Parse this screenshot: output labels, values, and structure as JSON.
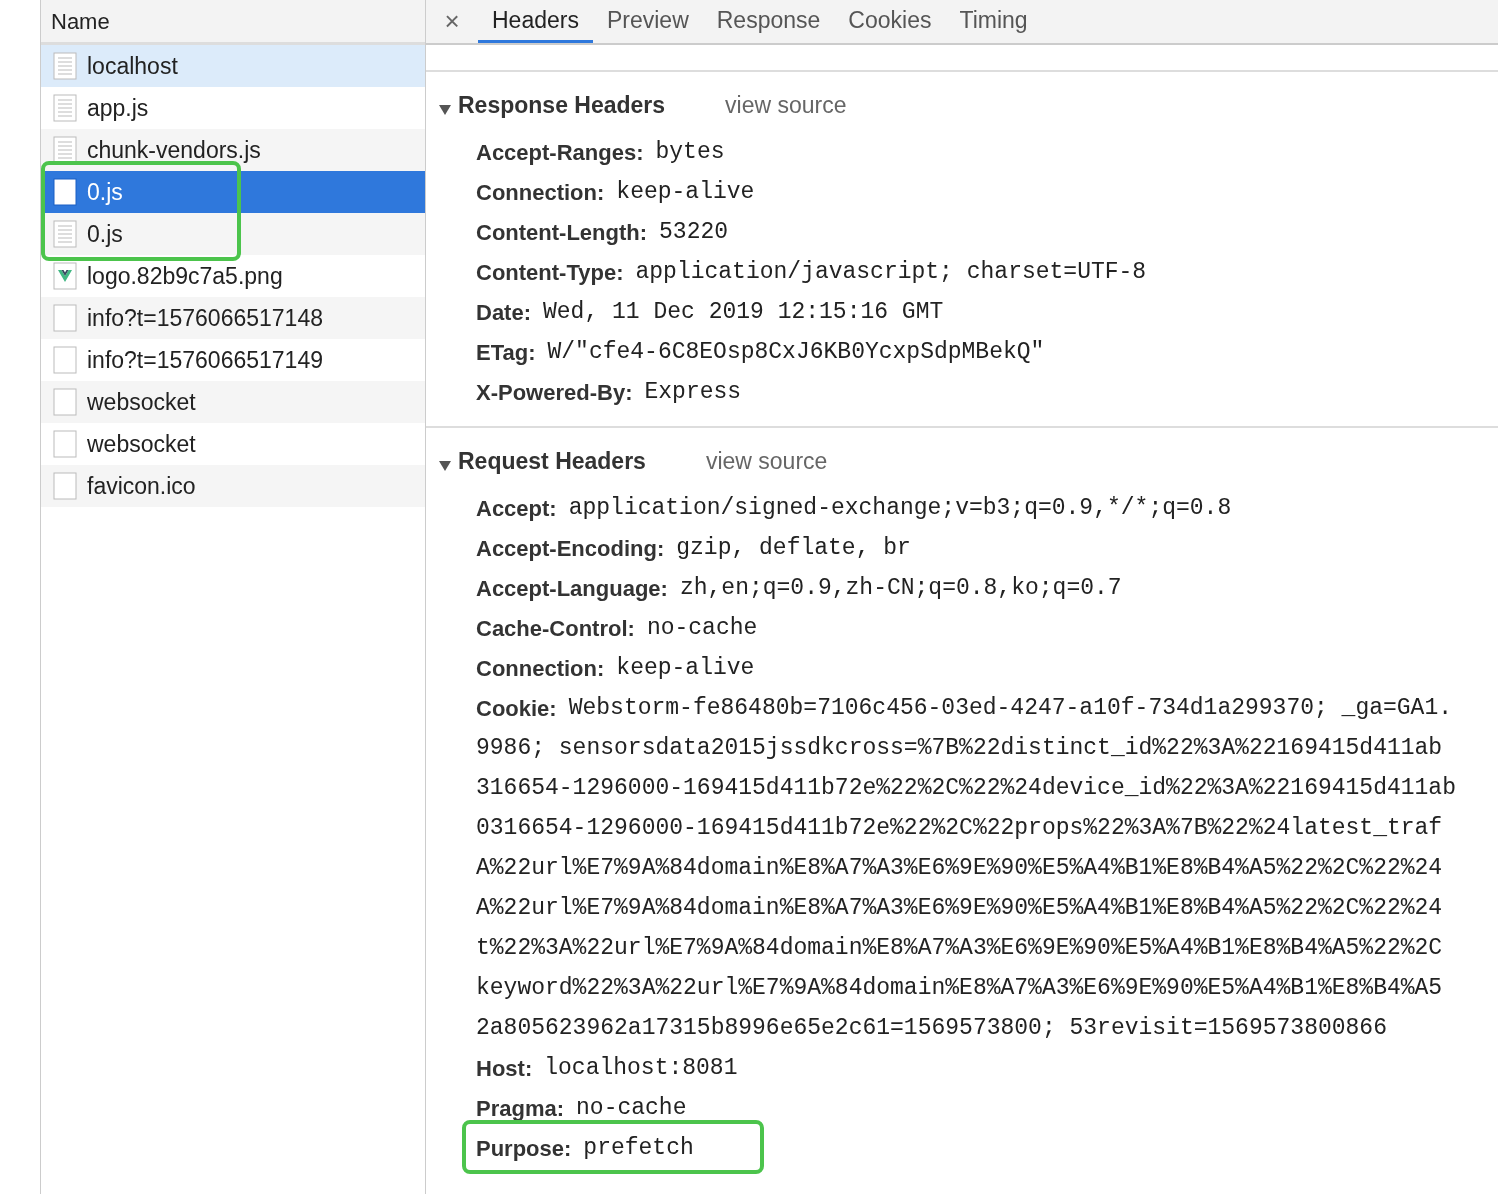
{
  "sidebar": {
    "column_header": "Name",
    "rows": [
      {
        "name": "localhost",
        "kind": "document",
        "selected": false,
        "hovered": true,
        "highlighted": false
      },
      {
        "name": "app.js",
        "kind": "document",
        "selected": false,
        "hovered": false,
        "highlighted": false
      },
      {
        "name": "chunk-vendors.js",
        "kind": "document",
        "selected": false,
        "hovered": false,
        "highlighted": false
      },
      {
        "name": "0.js",
        "kind": "document",
        "selected": true,
        "hovered": false,
        "highlighted": true
      },
      {
        "name": "0.js",
        "kind": "document",
        "selected": false,
        "hovered": false,
        "highlighted": true
      },
      {
        "name": "logo.82b9c7a5.png",
        "kind": "image",
        "selected": false,
        "hovered": false,
        "highlighted": false
      },
      {
        "name": "info?t=1576066517148",
        "kind": "blank",
        "selected": false,
        "hovered": false,
        "highlighted": false
      },
      {
        "name": "info?t=1576066517149",
        "kind": "blank",
        "selected": false,
        "hovered": false,
        "highlighted": false
      },
      {
        "name": "websocket",
        "kind": "blank",
        "selected": false,
        "hovered": false,
        "highlighted": false
      },
      {
        "name": "websocket",
        "kind": "blank",
        "selected": false,
        "hovered": false,
        "highlighted": false
      },
      {
        "name": "favicon.ico",
        "kind": "blank",
        "selected": false,
        "hovered": false,
        "highlighted": false
      }
    ]
  },
  "tabs": {
    "close": "×",
    "items": [
      {
        "label": "Headers",
        "selected": true
      },
      {
        "label": "Preview",
        "selected": false
      },
      {
        "label": "Response",
        "selected": false
      },
      {
        "label": "Cookies",
        "selected": false
      },
      {
        "label": "Timing",
        "selected": false
      }
    ]
  },
  "sections": [
    {
      "title": "Response Headers",
      "expanded": true,
      "link": "view source",
      "headers": [
        {
          "name": "Accept-Ranges:",
          "lines": [
            "bytes"
          ],
          "highlighted": false
        },
        {
          "name": "Connection:",
          "lines": [
            "keep-alive"
          ],
          "highlighted": false
        },
        {
          "name": "Content-Length:",
          "lines": [
            "53220"
          ],
          "highlighted": false
        },
        {
          "name": "Content-Type:",
          "lines": [
            "application/javascript; charset=UTF-8"
          ],
          "highlighted": false
        },
        {
          "name": "Date:",
          "lines": [
            "Wed, 11 Dec 2019 12:15:16 GMT"
          ],
          "highlighted": false
        },
        {
          "name": "ETag:",
          "lines": [
            "W/\"cfe4-6C8EOsp8CxJ6KB0YcxpSdpMBekQ\""
          ],
          "highlighted": false
        },
        {
          "name": "X-Powered-By:",
          "lines": [
            "Express"
          ],
          "highlighted": false
        }
      ]
    },
    {
      "title": "Request Headers",
      "expanded": true,
      "link": "view source",
      "headers": [
        {
          "name": "Accept:",
          "lines": [
            "application/signed-exchange;v=b3;q=0.9,*/*;q=0.8"
          ],
          "highlighted": false
        },
        {
          "name": "Accept-Encoding:",
          "lines": [
            "gzip, deflate, br"
          ],
          "highlighted": false
        },
        {
          "name": "Accept-Language:",
          "lines": [
            "zh,en;q=0.9,zh-CN;q=0.8,ko;q=0.7"
          ],
          "highlighted": false
        },
        {
          "name": "Cache-Control:",
          "lines": [
            "no-cache"
          ],
          "highlighted": false
        },
        {
          "name": "Connection:",
          "lines": [
            "keep-alive"
          ],
          "highlighted": false
        },
        {
          "name": "Cookie:",
          "lines": [
            "Webstorm-fe86480b=7106c456-03ed-4247-a10f-734d1a299370; _ga=GA1.",
            "9986; sensorsdata2015jssdkcross=%7B%22distinct_id%22%3A%22169415d411ab",
            "316654-1296000-169415d411b72e%22%2C%22%24device_id%22%3A%22169415d411ab",
            "0316654-1296000-169415d411b72e%22%2C%22props%22%3A%7B%22%24latest_traf",
            "A%22url%E7%9A%84domain%E8%A7%A3%E6%9E%90%E5%A4%B1%E8%B4%A5%22%2C%22%24",
            "A%22url%E7%9A%84domain%E8%A7%A3%E6%9E%90%E5%A4%B1%E8%B4%A5%22%2C%22%24",
            "t%22%3A%22url%E7%9A%84domain%E8%A7%A3%E6%9E%90%E5%A4%B1%E8%B4%A5%22%2C",
            "keyword%22%3A%22url%E7%9A%84domain%E8%A7%A3%E6%9E%90%E5%A4%B1%E8%B4%A5",
            "2a805623962a17315b8996e65e2c61=1569573800; 53revisit=1569573800866"
          ],
          "highlighted": false
        },
        {
          "name": "Host:",
          "lines": [
            "localhost:8081"
          ],
          "highlighted": false
        },
        {
          "name": "Pragma:",
          "lines": [
            "no-cache"
          ],
          "highlighted": false
        },
        {
          "name": "Purpose:",
          "lines": [
            "prefetch"
          ],
          "highlighted": true
        }
      ]
    }
  ]
}
